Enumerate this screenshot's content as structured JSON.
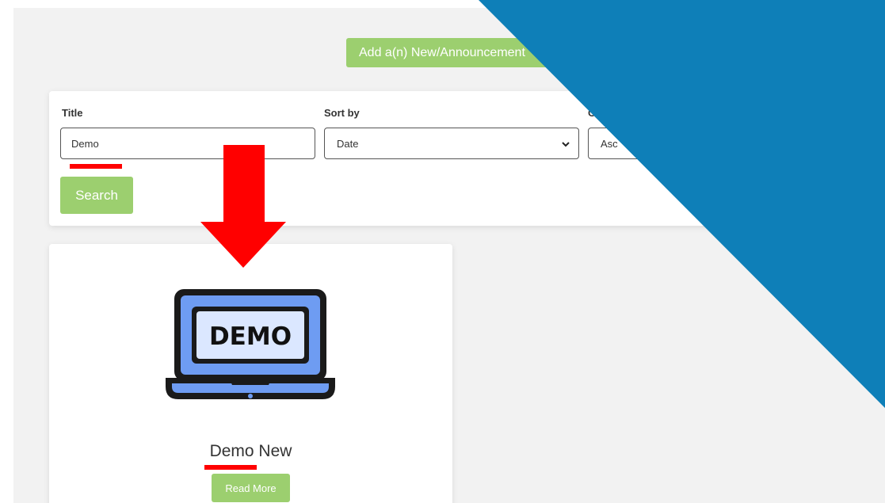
{
  "header": {
    "add_button_label": "Add a(n) New/Announcement"
  },
  "filters": {
    "title_label": "Title",
    "title_value": "Demo",
    "sort_by_label": "Sort by",
    "sort_by_value": "Date",
    "order_label": "O",
    "order_value": "Asc",
    "search_button_label": "Search"
  },
  "results": {
    "items": [
      {
        "icon_text": "DEMO",
        "title": "Demo New",
        "read_more_label": "Read More"
      }
    ]
  },
  "annotations": {
    "underline_color": "#ff0000",
    "arrow_color": "#ff0000",
    "overlay_color": "#0e7fb8"
  },
  "colors": {
    "accent_green": "#9ccf6f",
    "background": "#f2f2f2"
  }
}
